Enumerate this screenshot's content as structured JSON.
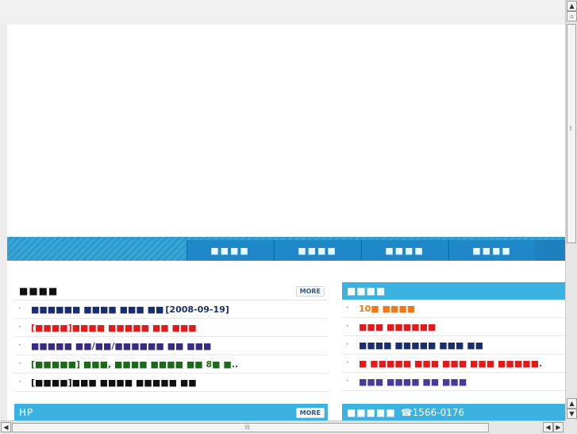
{
  "nav": {
    "tabs": [
      {
        "label": "■■■■"
      },
      {
        "label": "■■■■"
      },
      {
        "label": "■■■■"
      },
      {
        "label": "■■■■"
      }
    ]
  },
  "panels": {
    "notice": {
      "title": "■■■■",
      "more": "MORE",
      "items": [
        {
          "text": "■■■■■■ ■■■■ ■■■ ■■",
          "date": "[2008-09-19]",
          "color": "#1a2e6e"
        },
        {
          "text": "[■■■■]■■■■ ■■■■■ ■■ ■■■",
          "color": "#e21a1a"
        },
        {
          "text": "■■■■■ ■■/■■/■■■■■■ ■■ ■■■",
          "color": "#3a2a80"
        },
        {
          "text": "[■■■■■] ■■■, ■■■■ ■■■■ ■■ 8■ ■..",
          "color": "#1a6a1a"
        },
        {
          "text": "[■■■■]■■■ ■■■■ ■■■■■ ■■",
          "color": "#111111"
        }
      ]
    },
    "news": {
      "title": "■■■■",
      "items": [
        {
          "text": "10■ ■■■■",
          "color": "#f07818"
        },
        {
          "text": "■■■ ■■■■■■",
          "color": "#e21a1a"
        },
        {
          "text": "■■■■ ■■■■■ ■■■ ■■",
          "color": "#1a2e6e"
        },
        {
          "text": "■ ■■■■■ ■■■ ■■■ ■■■ ■■■■■.",
          "color": "#e21a1a"
        },
        {
          "text": "■■■ ■■■■ ■■ ■■■",
          "color": "#4a3aa0"
        }
      ]
    },
    "hp": {
      "title": "HP",
      "more": "MORE"
    },
    "contact": {
      "title": "■■■■■",
      "phone": "☎1566-0176"
    }
  },
  "scroll": {
    "up": "▲",
    "down": "▼",
    "left": "◀",
    "right": "▶"
  }
}
